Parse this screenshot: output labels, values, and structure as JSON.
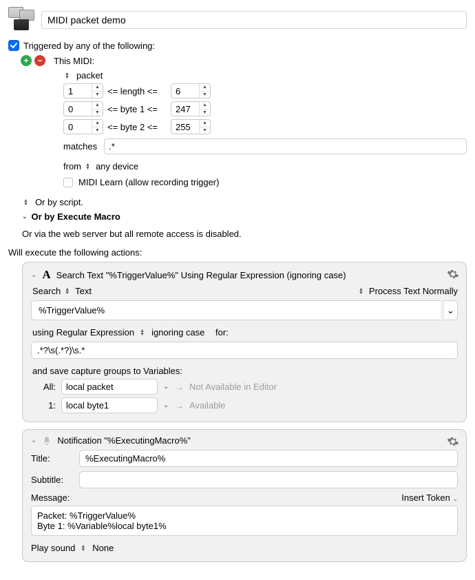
{
  "title": "MIDI packet demo",
  "trigger": {
    "enabled": true,
    "heading": "Triggered by any of the following:",
    "this_midi_label": "This MIDI:",
    "packet_label": "packet",
    "length": {
      "min": "1",
      "label": "<= length <=",
      "max": "6"
    },
    "byte1": {
      "min": "0",
      "label": "<= byte 1 <=",
      "max": "247"
    },
    "byte2": {
      "min": "0",
      "label": "<= byte 2 <=",
      "max": "255"
    },
    "matches_label": "matches",
    "matches_value": ".*",
    "from_label": "from",
    "from_value": "any device",
    "learn_label": "MIDI Learn (allow recording trigger)",
    "or_script": "Or by script.",
    "or_macro": "Or by Execute Macro",
    "or_web": "Or via the web server but all remote access is disabled.",
    "will_execute": "Will execute the following actions:"
  },
  "actions": {
    "search": {
      "title": "Search Text \"%TriggerValue%\" Using Regular Expression (ignoring case)",
      "search_label": "Search",
      "search_mode": "Text",
      "process_mode": "Process Text Normally",
      "search_value": "%TriggerValue%",
      "using_label": "using Regular Expression",
      "case_mode": "ignoring case",
      "for_label": "for:",
      "regex_value": ".*?\\s(.*?)\\s.*",
      "save_label": "and save capture groups to Variables:",
      "vars": [
        {
          "label": "All:",
          "name": "local packet",
          "hint": "Not Available in Editor"
        },
        {
          "label": "1:",
          "name": "local byte1",
          "hint": "Available"
        }
      ]
    },
    "notif": {
      "title": "Notification \"%ExecutingMacro%\"",
      "title_label": "Title:",
      "title_value": "%ExecutingMacro%",
      "subtitle_label": "Subtitle:",
      "subtitle_value": "",
      "message_label": "Message:",
      "insert_token": "Insert Token",
      "message_value": "Packet: %TriggerValue%\nByte 1: %Variable%local byte1%",
      "play_label": "Play sound",
      "play_value": "None"
    }
  }
}
